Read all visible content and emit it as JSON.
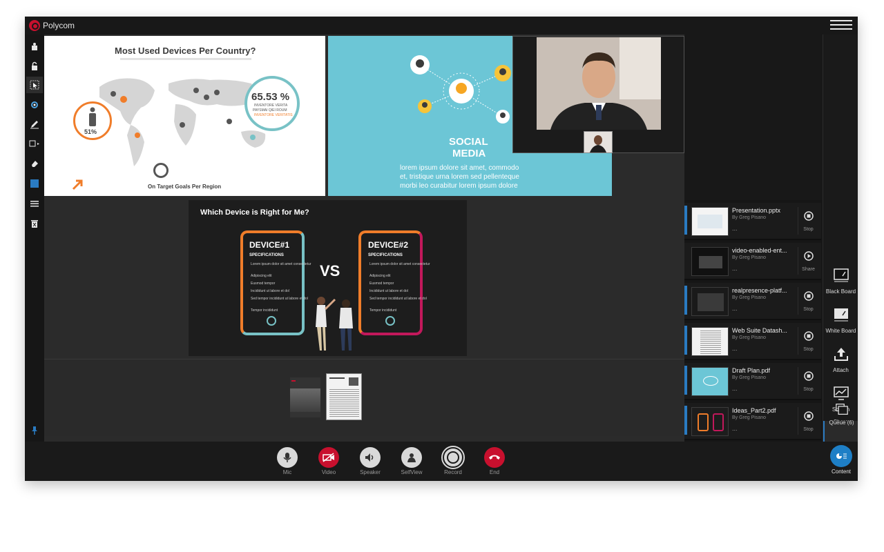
{
  "app": {
    "brand": "Polycom"
  },
  "slide_infographic": {
    "title": "Most Used Devices Per Country?",
    "stat_percent": "65.53 %",
    "stat_caption_1": "INVENTORE VERITA",
    "stat_caption_2": "PAYSMAI QIEI ROUM",
    "stat_caption_3": "INVENTORE VERITATIS",
    "person_percent": "51%",
    "subtitle": "On Target Goals Per Region"
  },
  "slide_social": {
    "title_line1": "SOCIAL",
    "title_line2": "MEDIA",
    "body_line1": "lorem ipsum dolore sit amet, commodo",
    "body_line2": "et, tristique urna lorem sed pellenteque",
    "body_line3": "morbi leo curabitur lorem ipsum dolore"
  },
  "slide_devices": {
    "title": "Which Device is Right for Me?",
    "device1": "DEVICE#1",
    "device2": "DEVICE#2",
    "specs_label": "SPECIFICATIONS",
    "vs": "VS",
    "spec_items": [
      "Lorem ipsum dolor sit amet consectetur",
      "Adipiscing elit",
      "Eusmod tempor",
      "Incididunt ut labore et dol",
      "Sed tempor incididunt ut labore et dol",
      "Tempor incididunt"
    ]
  },
  "queue": {
    "items": [
      {
        "name": "Presentation.pptx",
        "by": "By Greg Pisano",
        "dots": "...",
        "action": "Stop",
        "active": true
      },
      {
        "name": "video-enabled-ent...",
        "by": "By Greg Pisano",
        "dots": "...",
        "action": "Share",
        "active": false
      },
      {
        "name": "realpresence-platf...",
        "by": "By Greg Pisano",
        "dots": "...",
        "action": "Stop",
        "active": true
      },
      {
        "name": "Web Suite Datash...",
        "by": "By Greg Pisano",
        "dots": "...",
        "action": "Stop",
        "active": true
      },
      {
        "name": "Draft Plan.pdf",
        "by": "By Greg Pisano",
        "dots": "...",
        "action": "Stop",
        "active": true
      },
      {
        "name": "Ideas_Part2.pdf",
        "by": "By Greg Pisano",
        "dots": "...",
        "action": "Stop",
        "active": true
      }
    ]
  },
  "side_buttons": {
    "black_board": "Black Board",
    "white_board": "White Board",
    "attach": "Attach",
    "screen_share_1": "Screen",
    "screen_share_2": "Share",
    "queue": "Queue (6)"
  },
  "controls": {
    "mic": "Mic",
    "video": "Video",
    "speaker": "Speaker",
    "self_view": "SelfView",
    "record": "Record",
    "end": "End",
    "content": "Content"
  },
  "colors": {
    "accent_blue": "#2a7bc2",
    "end_red": "#c8102e",
    "social_teal": "#6cc6d6",
    "device_orange": "#f07d2a",
    "device_teal": "#78c2c6"
  }
}
